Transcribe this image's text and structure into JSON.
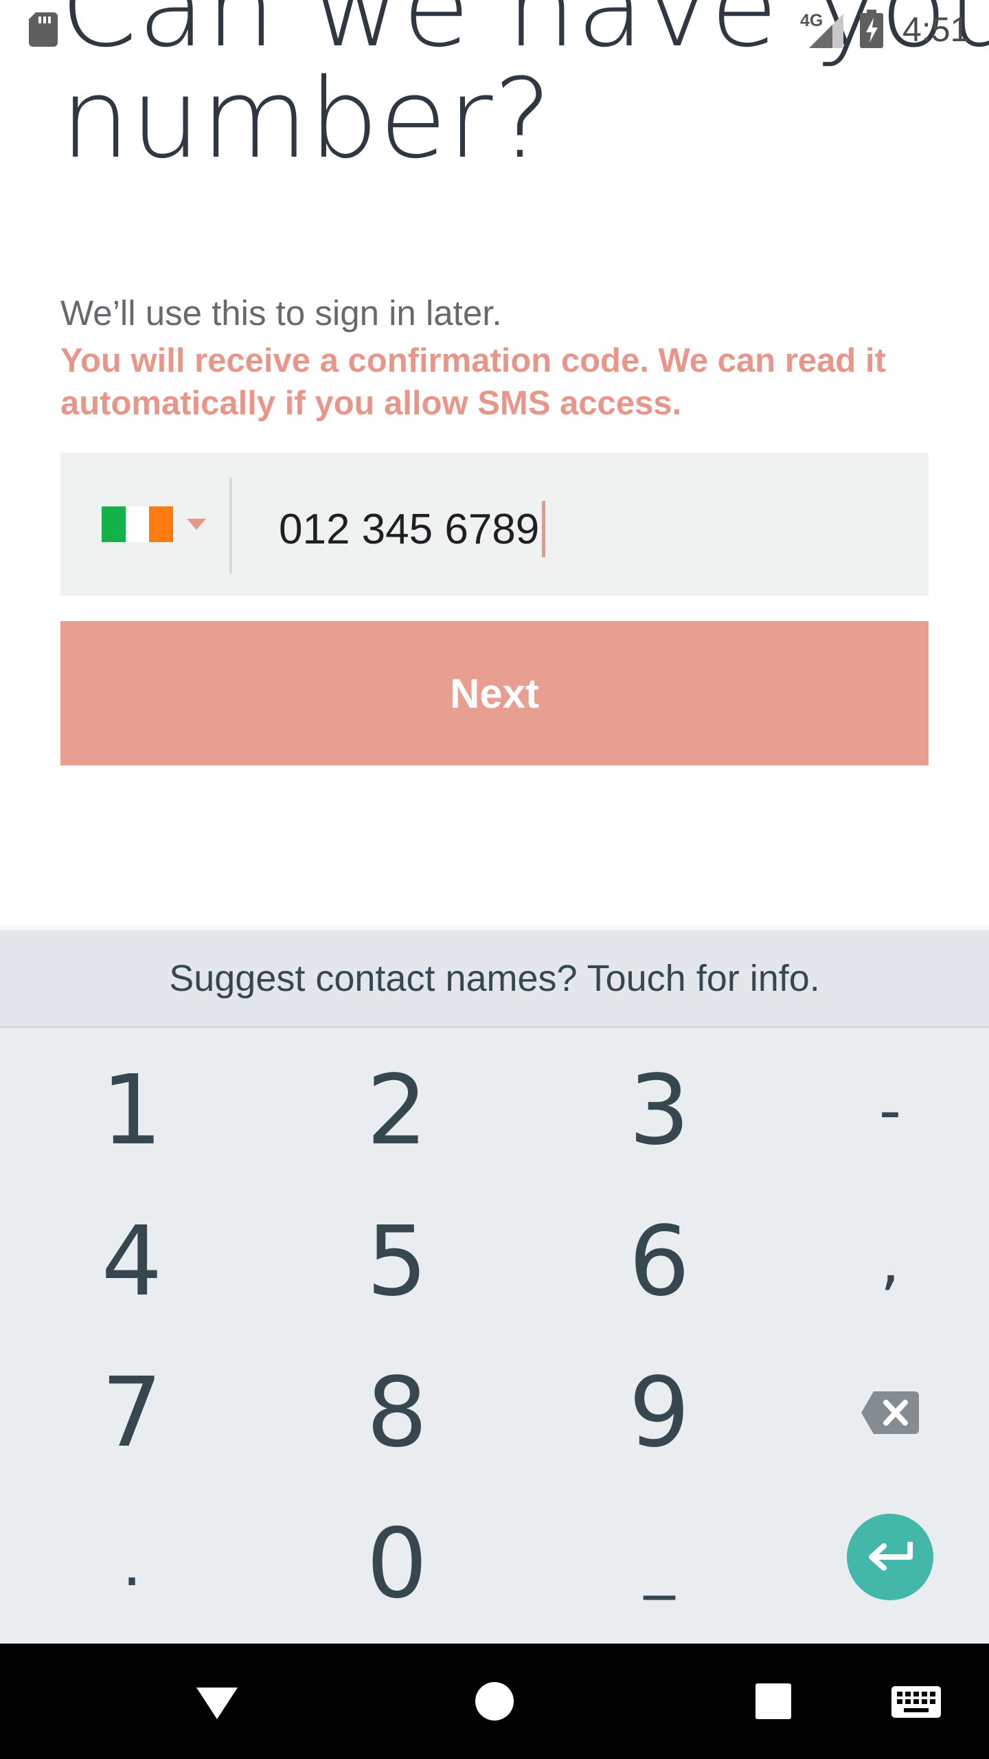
{
  "status_bar": {
    "network": "4G",
    "time": "4:51",
    "icons": [
      "sd-card-icon",
      "signal-icon",
      "battery-charging-icon"
    ]
  },
  "screen": {
    "title_line1": "Can we have your",
    "title_line2": "number?",
    "subtitle": "We’ll use this to sign in later.",
    "notice": "You will receive a confirmation code. We can read it automatically if you allow SMS access.",
    "country_flag": "ireland-flag-icon",
    "flag_colors": [
      "#14b24a",
      "#ffffff",
      "#ff7a10"
    ],
    "phone_value": "012 345 6789",
    "next_label": "Next"
  },
  "keyboard": {
    "suggestion": "Suggest contact names? Touch for info.",
    "keys": [
      "1",
      "2",
      "3",
      "-",
      "4",
      "5",
      "6",
      ",",
      "7",
      "8",
      "9",
      "backspace-icon",
      ".",
      "0",
      "_",
      "enter-icon"
    ]
  },
  "nav_bar": {
    "buttons": [
      "back-icon",
      "home-icon",
      "recents-icon",
      "keyboard-switch-icon"
    ]
  },
  "colors": {
    "accent": "#e9968a",
    "button": "#e89e90",
    "title": "#2f3742",
    "enter_key": "#44b8a8"
  }
}
